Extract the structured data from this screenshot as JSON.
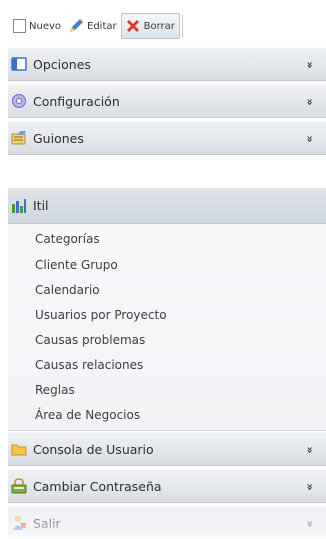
{
  "toolbar": {
    "new_label": "Nuevo",
    "edit_label": "Editar",
    "delete_label": "Borrar"
  },
  "menu": {
    "sections": [
      {
        "label": "Opciones",
        "icon": "window-icon",
        "expanded": false
      },
      {
        "label": "Configuración",
        "icon": "gear-icon",
        "expanded": false
      },
      {
        "label": "Guiones",
        "icon": "script-icon",
        "expanded": false
      },
      {
        "label": "Itil",
        "icon": "chart-icon",
        "expanded": true
      },
      {
        "label": "Consola de Usuario",
        "icon": "folder-icon",
        "expanded": false
      },
      {
        "label": "Cambiar Contraseña",
        "icon": "key-lock-icon",
        "expanded": false
      },
      {
        "label": "Salir",
        "icon": "user-exit-icon",
        "expanded": false
      }
    ],
    "itil_items": [
      "Categorías",
      "Cliente Grupo",
      "Calendario",
      "Usuarios por Proyecto",
      "Causas problemas",
      "Causas relaciones",
      "Reglas",
      "Área de Negocios"
    ],
    "collapse_glyph": "»"
  },
  "colors": {
    "header_top": "#eef0f4",
    "header_bottom": "#d9dde3",
    "submenu_bg": "#f4f6f8",
    "text": "#2e2e2e"
  }
}
